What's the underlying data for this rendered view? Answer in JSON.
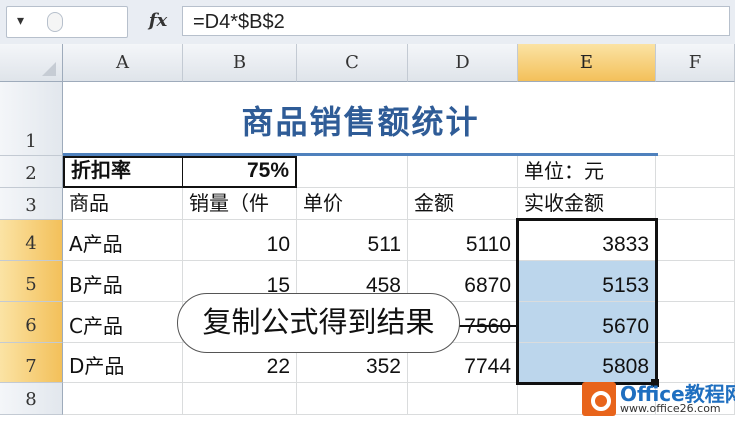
{
  "formula_bar": {
    "namebox_arrow": "▾",
    "fx_label": "fx",
    "formula": "=D4*$B$2"
  },
  "columns": [
    "A",
    "B",
    "C",
    "D",
    "E",
    "F"
  ],
  "rows": [
    "1",
    "2",
    "3",
    "4",
    "5",
    "6",
    "7",
    "8"
  ],
  "sheet": {
    "title": "商品销售额统计",
    "discount_label": "折扣率",
    "discount_value": "75%",
    "unit_label": "单位：元",
    "headers": [
      "商品",
      "销量（件",
      "单价",
      "金额",
      "实收金额"
    ],
    "data_rows": [
      [
        "A产品",
        "10",
        "511",
        "5110",
        "3833"
      ],
      [
        "B产品",
        "15",
        "458",
        "6870",
        "5153"
      ],
      [
        "C产品",
        "",
        "",
        "7560",
        "5670"
      ],
      [
        "D产品",
        "22",
        "352",
        "7744",
        "5808"
      ]
    ]
  },
  "callout_text": "复制公式得到结果",
  "watermark": {
    "name": "Office教程网",
    "url": "www.office26.com"
  }
}
